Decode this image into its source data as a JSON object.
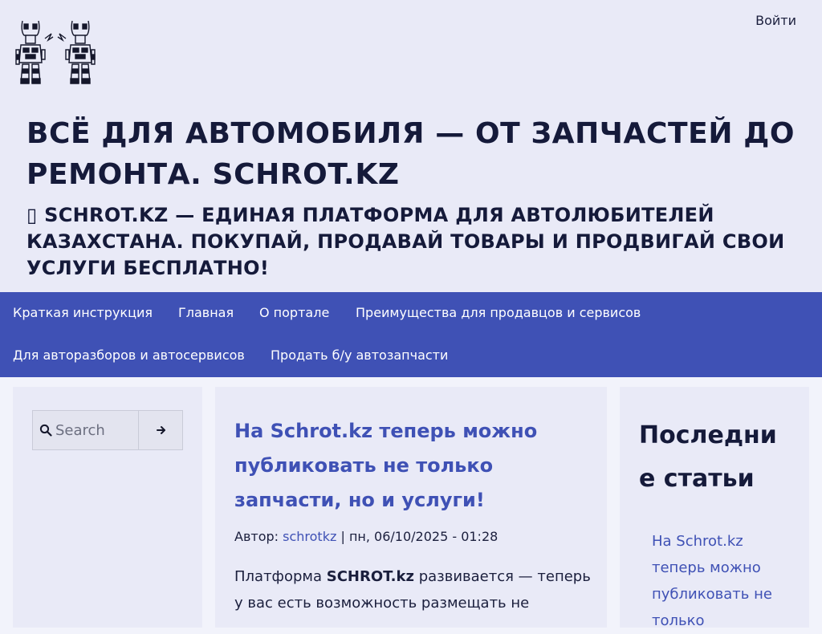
{
  "header": {
    "login_label": "Войти",
    "site_title": "ВСЁ ДЛЯ АВТОМОБИЛЯ — ОТ ЗАПЧАСТЕЙ ДО РЕМОНТА. SCHROT.KZ",
    "slogan": "▯ SCHROT.KZ — ЕДИНАЯ ПЛАТФОРМА ДЛЯ АВТОЛЮБИТЕЛЕЙ КАЗАХСТАНА. ПОКУПАЙ, ПРОДАВАЙ ТОВАРЫ И ПРОДВИГАЙ СВОИ УСЛУГИ БЕСПЛАТНО!",
    "logo_icon": "robot-logo-icon"
  },
  "nav": {
    "items": [
      "Краткая инструкция",
      "Главная",
      "О портале",
      "Преимущества для продавцов и сервисов",
      "Для авторазборов и автосервисов",
      "Продать б/у автозапчасти"
    ]
  },
  "search": {
    "placeholder": "Search",
    "search_icon": "search-icon",
    "submit_icon": "arrow-right-icon"
  },
  "article": {
    "title": "На Schrot.kz теперь можно публиковать не только запчасти, но и услуги!",
    "author_label": "Автор:",
    "author": "schrotkz",
    "separator": "|",
    "date": "пн, 06/10/2025 - 01:28",
    "body_prefix": "Платформа",
    "body_brand": "SCHROT.kz",
    "body_suffix": "развивается — теперь у вас есть возможность размещать не"
  },
  "sidebar": {
    "heading": "Последние статьи",
    "recent_link": "На Schrot.kz теперь можно публиковать не только"
  },
  "colors": {
    "accent": "#3f51b5",
    "header_bg": "#e9eaf7",
    "text_dark": "#151a3a"
  }
}
